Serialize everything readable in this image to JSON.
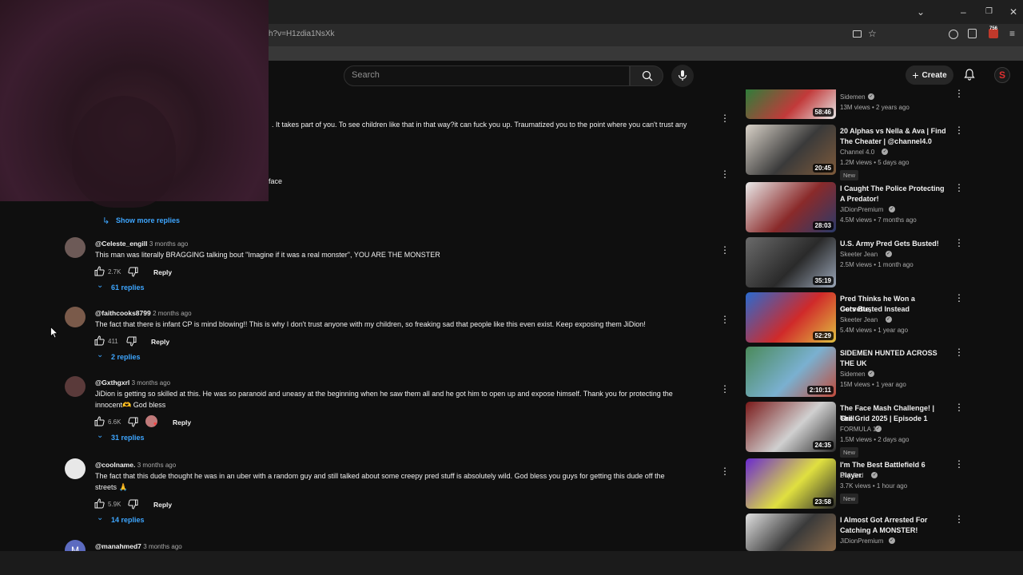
{
  "browser": {
    "url_fragment": "h?v=H1zdia1NsXk",
    "badge_count": "756"
  },
  "header": {
    "search_placeholder": "Search",
    "create_label": "Create"
  },
  "comments_partial": {
    "line1": ". It takes part of you. To see children like that in that way?it can fuck you up. Traumatized you to the point where you can't trust any",
    "line2": "face",
    "show_more": "Show more replies"
  },
  "comments": [
    {
      "handle": "@Celeste_engill",
      "time": "3 months ago",
      "text": [
        "This man was literally BRAGGING talking bout \"Imagine if it was a real monster\", YOU ARE THE MONSTER"
      ],
      "likes": "2.7K",
      "reply": "Reply",
      "replies": "61 replies",
      "avatar_color": "#6d5a57"
    },
    {
      "handle": "@faithcooks8799",
      "time": "2 months ago",
      "text": [
        "The fact that there is infant CP is mind blowing!! This is why I don't trust anyone with my children, so freaking sad that people like this even exist. Keep exposing them JiDion!"
      ],
      "likes": "411",
      "reply": "Reply",
      "replies": "2 replies",
      "avatar_color": "#7a5a4a"
    },
    {
      "handle": "@Gxthgxrl",
      "time": "3 months ago",
      "text": [
        "JiDion is getting so skilled at this. He was so paranoid and uneasy at the beginning when he saw them all and he got him to open up and expose himself. Thank you for protecting the",
        "innocent🫶 God bless"
      ],
      "likes": "6.6K",
      "reply": "Reply",
      "replies": "31 replies",
      "avatar_color": "#5a3a3a"
    },
    {
      "handle": "@coolname.",
      "time": "3 months ago",
      "text": [
        "The fact that this dude thought he was in an uber with a random guy and still talked about some creepy pred stuff is absolutely wild. God bless you guys for getting this dude off the",
        "streets 🙏"
      ],
      "likes": "5.9K",
      "reply": "Reply",
      "replies": "14 replies",
      "avatar_color": "#e8e8e8"
    },
    {
      "handle": "@manahmed7",
      "time": "3 months ago",
      "avatar_letter": "M",
      "avatar_color": "#5c6bc0"
    }
  ],
  "sidebar": [
    {
      "title": [
        "Sidemen"
      ],
      "channel": "",
      "meta": "13M views • 2 years ago",
      "duration": "58:46",
      "partial": true,
      "colors": [
        "#2f7d3a",
        "#c23a3a",
        "#e6e6e6"
      ]
    },
    {
      "title": [
        "20 Alphas vs Nella & Ava | Find",
        "The Cheater | @channel4.0"
      ],
      "channel": "Channel 4.0",
      "meta": "1.2M views • 5 days ago",
      "duration": "20:45",
      "new": "New",
      "colors": [
        "#d9d2c8",
        "#3a3a3a",
        "#7e5a3a"
      ]
    },
    {
      "title": [
        "I Caught The Police Protecting",
        "A Predator!"
      ],
      "channel": "JiDionPremium",
      "meta": "4.5M views • 7 months ago",
      "duration": "28:03",
      "colors": [
        "#eaeaea",
        "#8a2a2a",
        "#2a3a6a"
      ]
    },
    {
      "title": [
        "U.S. Army Pred Gets Busted!"
      ],
      "channel": "Skeeter Jean",
      "meta": "2.5M views • 1 month ago",
      "duration": "35:19",
      "colors": [
        "#6a6a6a",
        "#2a2a2a",
        "#9aa6b8"
      ]
    },
    {
      "title": [
        "Pred Thinks he Won a Corvette,",
        "Gets Busted Instead"
      ],
      "channel": "Skeeter Jean",
      "meta": "5.4M views • 1 year ago",
      "duration": "52:29",
      "colors": [
        "#2a6ad0",
        "#d02a2a",
        "#e0c040"
      ]
    },
    {
      "title": [
        "SIDEMEN HUNTED ACROSS",
        "THE UK"
      ],
      "channel": "Sidemen",
      "meta": "15M views • 1 year ago",
      "duration": "2:10:11",
      "colors": [
        "#4a8a5a",
        "#7ab0d0",
        "#c04a3a"
      ]
    },
    {
      "title": [
        "The Face Mash Challenge! | Grill",
        "The Grid 2025 | Episode 1"
      ],
      "channel": "FORMULA 1",
      "meta": "1.5M views • 2 days ago",
      "duration": "24:35",
      "new": "New",
      "colors": [
        "#7a1a1a",
        "#d0d0d0",
        "#2a2a2a"
      ]
    },
    {
      "title": [
        "I'm The Best Battlefield 6 Player"
      ],
      "channel": "Deji 2nd",
      "meta": "3.7K views • 1 hour ago",
      "duration": "23:58",
      "new": "New",
      "colors": [
        "#6a2ad0",
        "#e0e040",
        "#2a2a2a"
      ]
    },
    {
      "title": [
        "I Almost Got Arrested For",
        "Catching A MONSTER!"
      ],
      "channel": "JiDionPremium",
      "meta": "",
      "duration": "",
      "partial_bottom": true,
      "colors": [
        "#e0e0e0",
        "#3a3a3a",
        "#8a6a4a"
      ]
    }
  ]
}
